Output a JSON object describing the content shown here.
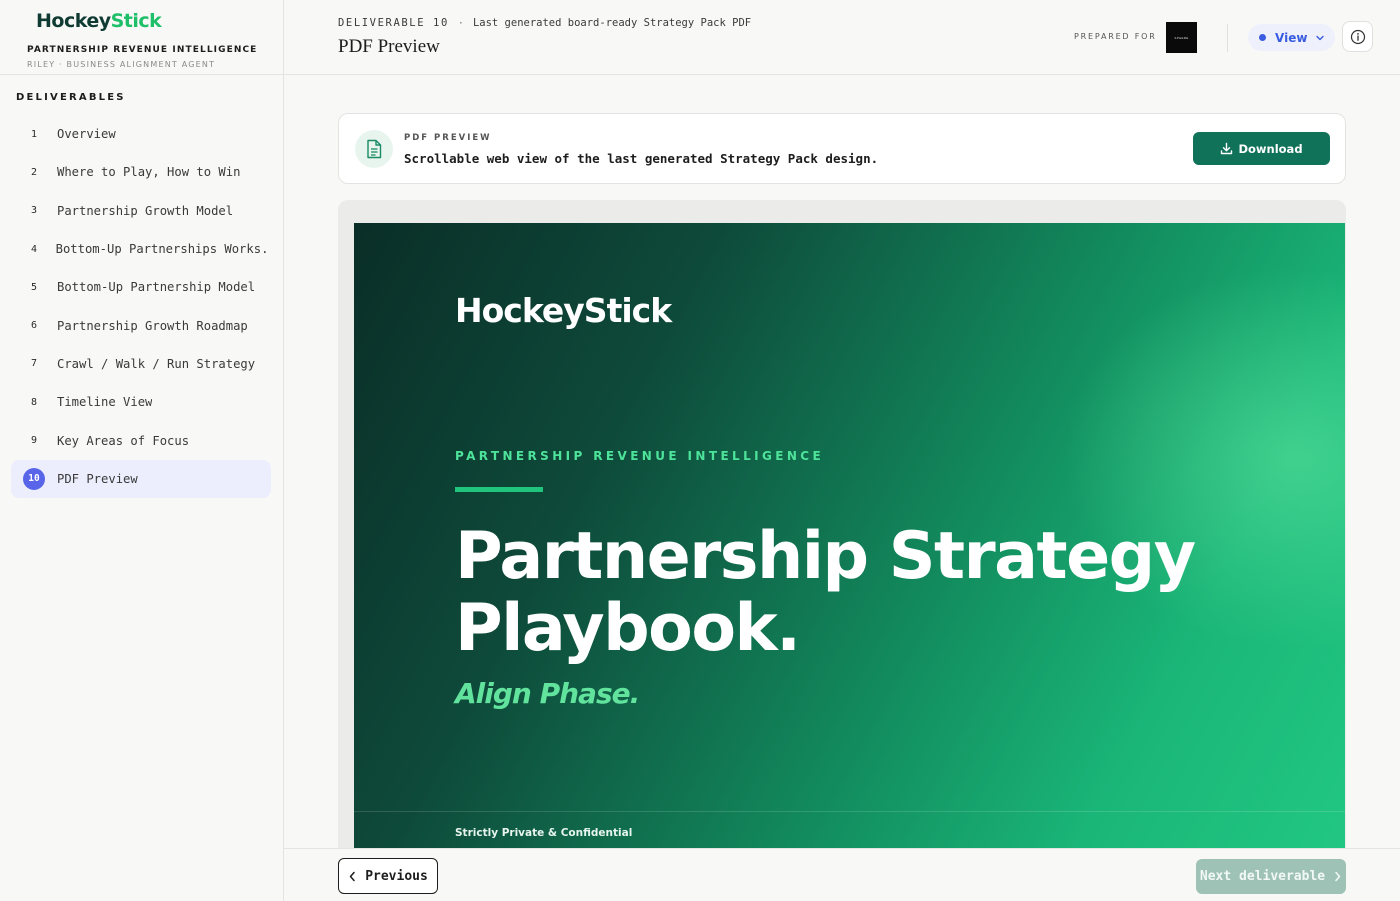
{
  "brand": {
    "logo_part1": "Hockey",
    "logo_part2": "Stick",
    "subtitle": "PARTNERSHIP REVENUE INTELLIGENCE",
    "agent": "RILEY · BUSINESS ALIGNMENT AGENT"
  },
  "sidebar": {
    "heading": "DELIVERABLES",
    "items": [
      {
        "num": "1",
        "label": "Overview"
      },
      {
        "num": "2",
        "label": "Where to Play, How to Win"
      },
      {
        "num": "3",
        "label": "Partnership Growth Model"
      },
      {
        "num": "4",
        "label": "Bottom-Up Partnerships Works..."
      },
      {
        "num": "5",
        "label": "Bottom-Up Partnership Model"
      },
      {
        "num": "6",
        "label": "Partnership Growth Roadmap"
      },
      {
        "num": "7",
        "label": "Crawl / Walk / Run Strategy"
      },
      {
        "num": "8",
        "label": "Timeline View"
      },
      {
        "num": "9",
        "label": "Key Areas of Focus"
      },
      {
        "num": "10",
        "label": "PDF Preview",
        "active": true
      }
    ]
  },
  "header": {
    "deliverable": "DELIVERABLE 10",
    "separator": "·",
    "description": "Last generated board-ready Strategy Pack PDF",
    "title": "PDF Preview",
    "prepared_for": "PREPARED FOR",
    "client_logo_text": "SPHERE",
    "view_label": "View"
  },
  "card": {
    "kicker": "PDF PREVIEW",
    "text": "Scrollable web view of the last generated Strategy Pack design.",
    "download_label": "Download"
  },
  "pdf_page": {
    "logo": "HockeyStick",
    "kicker": "PARTNERSHIP REVENUE INTELLIGENCE",
    "title": "Partnership Strategy Playbook.",
    "subtitle": "Align Phase.",
    "footer": "Strictly Private & Confidential"
  },
  "footer": {
    "previous_label": "Previous",
    "next_label": "Next deliverable"
  },
  "colors": {
    "brand_dark": "#0f3b33",
    "brand_green": "#1fbf6a",
    "accent_blue": "#5865e8",
    "download_bg": "#11725a",
    "next_disabled_bg": "#9fc2b7"
  },
  "icons": {
    "card": "document-icon",
    "download": "download-icon",
    "view": "chevron-down-icon",
    "info": "info-icon",
    "previous": "chevron-left-icon",
    "next": "chevron-right-icon"
  }
}
